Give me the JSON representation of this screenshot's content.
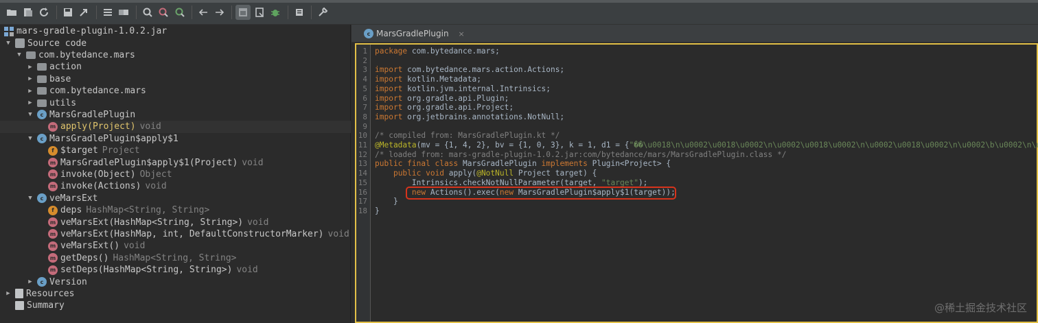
{
  "toolbar": {
    "icons": [
      "open-folder-icon",
      "save-all-icon",
      "refresh-icon",
      "save-icon",
      "export-icon",
      "deobfuscate-icon",
      "sync-icon",
      "search-icon",
      "search-class-icon",
      "search-usage-icon",
      "back-arrow-icon",
      "forward-arrow-icon",
      "decompile-icon",
      "bookmark-icon",
      "debug-bug-icon",
      "log-icon",
      "settings-wrench-icon"
    ]
  },
  "tree": {
    "jar": "mars-gradle-plugin-1.0.2.jar",
    "source_code": "Source code",
    "package_root": "com.bytedance.mars",
    "subpackages": [
      "action",
      "base",
      "com.bytedance.mars",
      "utils"
    ],
    "class1": {
      "name": "MarsGradlePlugin",
      "method": "apply(Project)",
      "method_ret": "void"
    },
    "class2": {
      "name": "MarsGradlePlugin$apply$1",
      "members": [
        {
          "kind": "field",
          "name": "$target",
          "type": "Project"
        },
        {
          "kind": "method",
          "name": "MarsGradlePlugin$apply$1(Project)",
          "type": "void"
        },
        {
          "kind": "method",
          "name": "invoke(Object)",
          "type": "Object"
        },
        {
          "kind": "method",
          "name": "invoke(Actions)",
          "type": "void"
        }
      ]
    },
    "class3": {
      "name": "veMarsExt",
      "members": [
        {
          "kind": "field",
          "name": "deps",
          "type": "HashMap<String, String>"
        },
        {
          "kind": "method",
          "name": "veMarsExt(HashMap<String, String>)",
          "type": "void"
        },
        {
          "kind": "method",
          "name": "veMarsExt(HashMap, int, DefaultConstructorMarker)",
          "type": "void"
        },
        {
          "kind": "method",
          "name": "veMarsExt()",
          "type": "void"
        },
        {
          "kind": "method",
          "name": "getDeps()",
          "type": "HashMap<String, String>"
        },
        {
          "kind": "method",
          "name": "setDeps(HashMap<String, String>)",
          "type": "void"
        }
      ]
    },
    "class4": "Version",
    "resources": "Resources",
    "summary": "Summary"
  },
  "editor": {
    "tab_label": "MarsGradlePlugin",
    "tab_close": "×",
    "line_numbers": [
      "1",
      "2",
      "3",
      "4",
      "5",
      "6",
      "7",
      "8",
      "9",
      "10",
      "11",
      "12",
      "13",
      "14",
      "15",
      "16",
      "17",
      "18"
    ],
    "lines": [
      [
        [
          "kw",
          "package"
        ],
        [
          "t",
          " com.bytedance.mars;"
        ]
      ],
      [],
      [
        [
          "kw",
          "import"
        ],
        [
          "t",
          " com.bytedance.mars.action.Actions;"
        ]
      ],
      [
        [
          "kw",
          "import"
        ],
        [
          "t",
          " kotlin.Metadata;"
        ]
      ],
      [
        [
          "kw",
          "import"
        ],
        [
          "t",
          " kotlin.jvm.internal.Intrinsics;"
        ]
      ],
      [
        [
          "kw",
          "import"
        ],
        [
          "t",
          " org.gradle.api.Plugin;"
        ]
      ],
      [
        [
          "kw",
          "import"
        ],
        [
          "t",
          " org.gradle.api.Project;"
        ]
      ],
      [
        [
          "kw",
          "import"
        ],
        [
          "t",
          " org.jetbrains.annotations.NotNull;"
        ]
      ],
      [],
      [
        [
          "cm",
          "/* compiled from: MarsGradlePlugin.kt */"
        ]
      ],
      [
        [
          "ann",
          "@Metadata"
        ],
        [
          "t",
          "(mv = {1, 4, 2}, bv = {1, 0, 3}, k = 1, d1 = {"
        ],
        [
          "str",
          "\"��\\u0018\\n\\u0002\\u0018\\u0002\\n\\u0002\\u0018\\u0002\\n\\u0002\\u0018\\u0002\\n\\u0002\\b\\u0002\\n\\u0002\\u0"
        ]
      ],
      [
        [
          "cm",
          "/* loaded from: mars-gradle-plugin-1.0.2.jar:com/bytedance/mars/MarsGradlePlugin.class */"
        ]
      ],
      [
        [
          "kw",
          "public final class"
        ],
        [
          "t",
          " MarsGradlePlugin "
        ],
        [
          "kw",
          "implements"
        ],
        [
          "t",
          " Plugin<Project> {"
        ]
      ],
      [
        [
          "t",
          "    "
        ],
        [
          "kw",
          "public void"
        ],
        [
          "t",
          " apply("
        ],
        [
          "ann",
          "@NotNull"
        ],
        [
          "t",
          " Project target) {"
        ]
      ],
      [
        [
          "t",
          "        Intrinsics.checkNotNullParameter(target, "
        ],
        [
          "str",
          "\"target\""
        ],
        [
          "t",
          ");"
        ]
      ],
      [
        [
          "t",
          "        "
        ],
        [
          "kw",
          "new"
        ],
        [
          "t",
          " Actions().exec("
        ],
        [
          "kw",
          "new"
        ],
        [
          "t",
          " MarsGradlePlugin$apply$1(target));"
        ]
      ],
      [
        [
          "t",
          "    }"
        ]
      ],
      [
        [
          "t",
          "}"
        ]
      ]
    ]
  },
  "watermark": "@稀土掘金技术社区"
}
